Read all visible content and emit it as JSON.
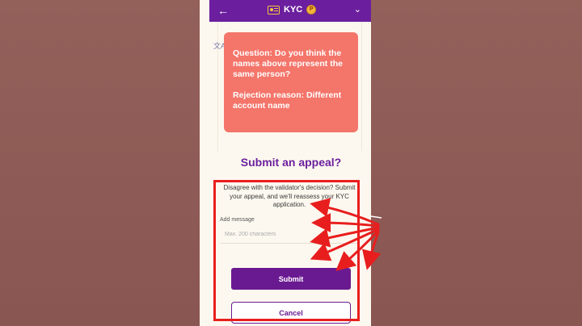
{
  "header": {
    "title": "KYC",
    "back_icon": "arrow-left-icon",
    "menu_icon": "chevron-down-icon",
    "coin_glyph": "P"
  },
  "card": {
    "question": "Question: Do you think the names above represent the same person?",
    "rejection": "Rejection reason: Different account name"
  },
  "appeal": {
    "title": "Submit an appeal?",
    "description": "Disagree with the validator's decision? Submit your appeal, and we'll reassess your KYC application.",
    "field_label": "Add message",
    "placeholder": "Max. 200 characters",
    "submit_label": "Submit",
    "cancel_label": "Cancel"
  },
  "colors": {
    "brand_purple": "#6b1f9e",
    "card_coral": "#f4756a",
    "annotation_red": "#e81e1e"
  }
}
